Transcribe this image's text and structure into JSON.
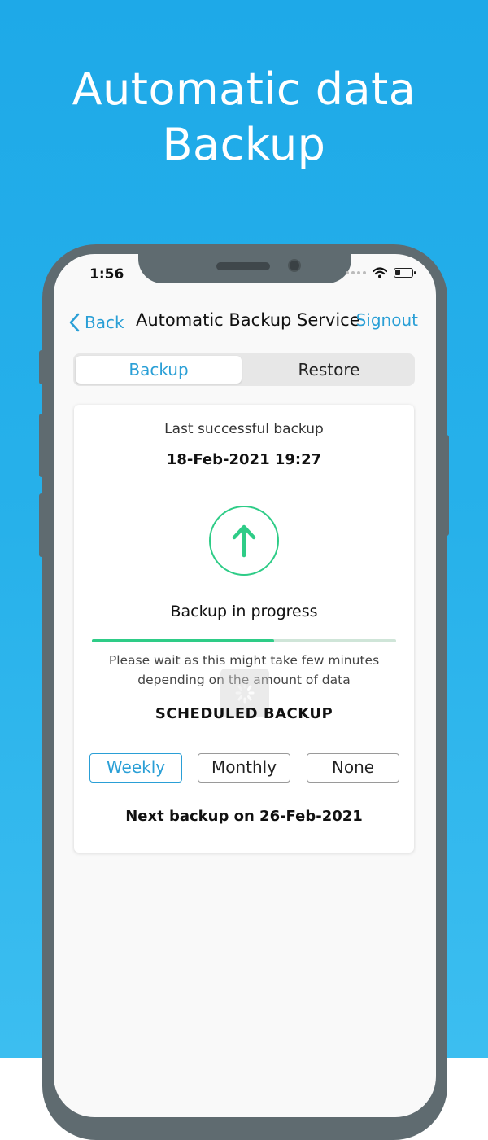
{
  "headline": {
    "line1": "Automatic data",
    "line2": "Backup"
  },
  "status_bar": {
    "time": "1:56"
  },
  "nav": {
    "back_label": "Back",
    "title": "Automatic Backup Service",
    "signout_label": "Signout"
  },
  "tabs": [
    {
      "label": "Backup",
      "selected": true
    },
    {
      "label": "Restore",
      "selected": false
    }
  ],
  "backup_card": {
    "last_label": "Last successful backup",
    "last_date": "18-Feb-2021 19:27",
    "status": "Backup in progress",
    "progress_percent": 60,
    "wait_line1": "Please wait as this might take few minutes",
    "wait_line2": "depending on the  amount of  data",
    "schedule_title": "SCHEDULED BACKUP",
    "options": [
      {
        "label": "Weekly",
        "selected": true
      },
      {
        "label": "Monthly",
        "selected": false
      },
      {
        "label": "None",
        "selected": false
      }
    ],
    "next_backup": "Next backup on 26-Feb-2021"
  },
  "colors": {
    "accent_blue": "#2a9fd6",
    "progress_green": "#2ecc87",
    "background": "#1ea9e8"
  }
}
